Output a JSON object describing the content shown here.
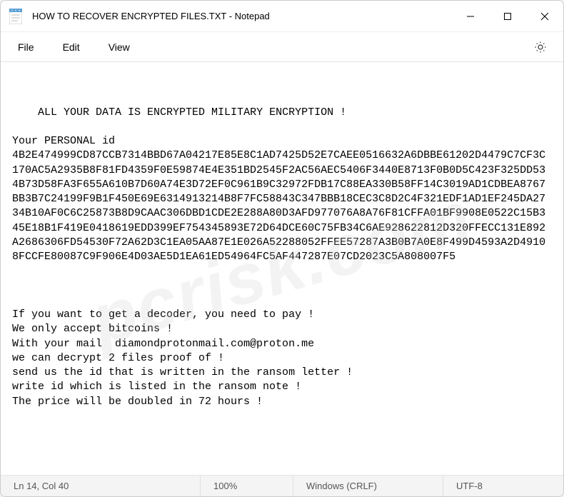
{
  "window": {
    "title": "HOW TO RECOVER ENCRYPTED FILES.TXT - Notepad"
  },
  "menu": {
    "file": "File",
    "edit": "Edit",
    "view": "View"
  },
  "content": {
    "text": "ALL YOUR DATA IS ENCRYPTED MILITARY ENCRYPTION !\n\nYour PERSONAL id\n4B2E474999CD87CCB7314BBD67A04217E85E8C1AD7425D52E7CAEE0516632A6DBBE61202D4479C7CF3C170AC5A2935B8F81FD4359F0E59874E4E351BD2545F2AC56AEC5406F3440E8713F0B0D5C423F325DD534B73D58FA3F655A610B7D60A74E3D72EF0C961B9C32972FDB17C88EA330B58FF14C3019AD1CDBEA8767BB3B7C24199F9B1F450E69E6314913214B8F7FC58843C347BBB18CEC3C8D2C4F321EDF1AD1EF245DA2734B10AF0C6C25873B8D9CAAC306DBD1CDE2E288A80D3AFD977076A8A76F81CFFA01BF9908E0522C15B345E18B1F419E0418619EDD399EF754345893E72D64DCE60C75FB34C6AE928622812D320FFECC131E892A2686306FD54530F72A62D3C1EA05AA87E1E026A52288052FFEE57287A3B0B7A0E8F499D4593A2D49108FCCFE80087C9F906E4D03AE5D1EA61ED54964FC5AF447287E07CD2023C5A808007F5\n\n\n\nIf you want to get a decoder, you need to pay !\nWe only accept bitcoins !\nWith your mail  diamondprotonmail.com@proton.me\nwe can decrypt 2 files proof of !\nsend us the id that is written in the ransom letter !\nwrite id which is listed in the ransom note !\nThe price will be doubled in 72 hours !"
  },
  "statusbar": {
    "position": "Ln 14, Col 40",
    "zoom": "100%",
    "line_ending": "Windows (CRLF)",
    "encoding": "UTF-8"
  },
  "watermark": "pcrisk.com"
}
